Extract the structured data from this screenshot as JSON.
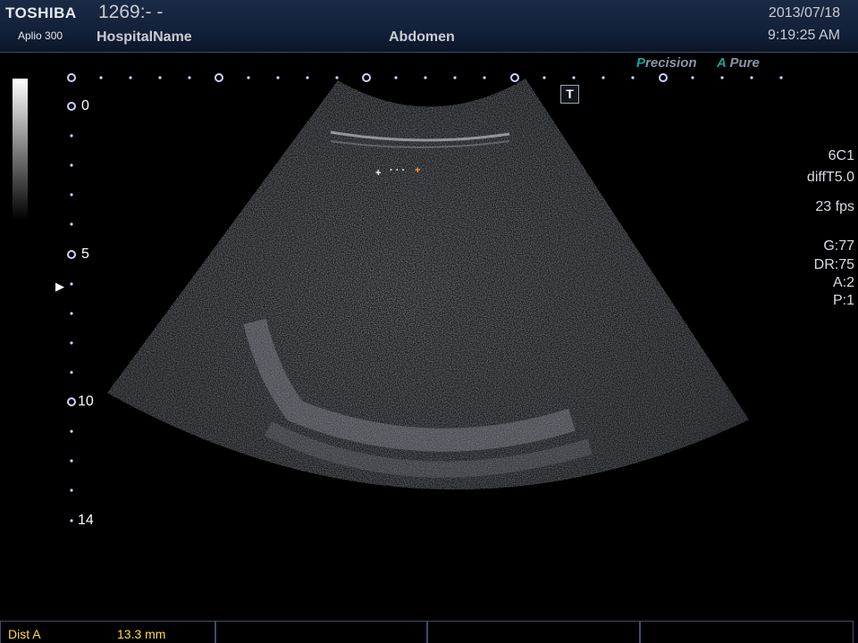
{
  "header": {
    "brand": "TOSHIBA",
    "model": "Aplio 300",
    "patient_id": "1269:- -",
    "hospital": "HospitalName",
    "preset": "Abdomen",
    "date": "2013/07/18",
    "time": "9:19:25 AM"
  },
  "badges": {
    "precision_mark": "P",
    "precision_rest": "recision",
    "apure_mark": "A",
    "apure_rest": "Pure"
  },
  "t_marker": "T",
  "depth_scale": {
    "labels": [
      "0",
      "5",
      "10",
      "14"
    ]
  },
  "focus_marker": "▶",
  "params": {
    "probe": "6C1",
    "mode": "diffT5.0",
    "frame_rate": "23 fps",
    "gain": "G:77",
    "dynamic_range": "DR:75",
    "a": "A:2",
    "p": "P:1"
  },
  "calipers": {
    "start": "+",
    "end": "+",
    "dotted": "· · ·"
  },
  "footer": {
    "dist_label": "Dist  A",
    "dist_value": "13.3  mm"
  },
  "colors": {
    "header_bg": "#13203a",
    "measure_yellow": "#ffdd44",
    "brand_teal": "#16a49a",
    "caliper_orange": "#ff9a2a"
  }
}
